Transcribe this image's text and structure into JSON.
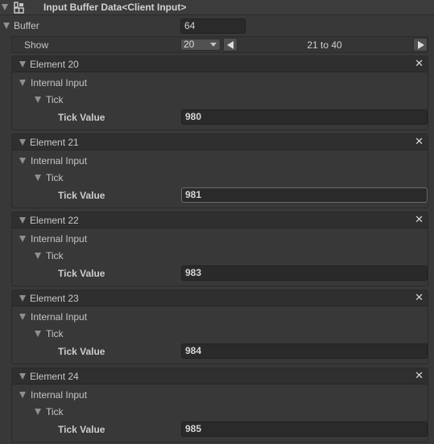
{
  "header": {
    "title": "Input Buffer Data<Client Input>"
  },
  "buffer": {
    "label": "Buffer",
    "value": "64"
  },
  "pagination": {
    "show_label": "Show",
    "page_size": "20",
    "range_text": "21 to 40"
  },
  "elements": [
    {
      "title": "Element 20",
      "internal_label": "Internal Input",
      "tick_label": "Tick",
      "tick_value_label": "Tick Value",
      "tick_value": "980"
    },
    {
      "title": "Element 21",
      "internal_label": "Internal Input",
      "tick_label": "Tick",
      "tick_value_label": "Tick Value",
      "tick_value": "981"
    },
    {
      "title": "Element 22",
      "internal_label": "Internal Input",
      "tick_label": "Tick",
      "tick_value_label": "Tick Value",
      "tick_value": "983"
    },
    {
      "title": "Element 23",
      "internal_label": "Internal Input",
      "tick_label": "Tick",
      "tick_value_label": "Tick Value",
      "tick_value": "984"
    },
    {
      "title": "Element 24",
      "internal_label": "Internal Input",
      "tick_label": "Tick",
      "tick_value_label": "Tick Value",
      "tick_value": "985"
    }
  ],
  "icons": {
    "component": "component-icon",
    "fold": "triangle-down-icon",
    "close": "close-icon",
    "prev": "arrow-left-icon",
    "next": "arrow-right-icon"
  }
}
